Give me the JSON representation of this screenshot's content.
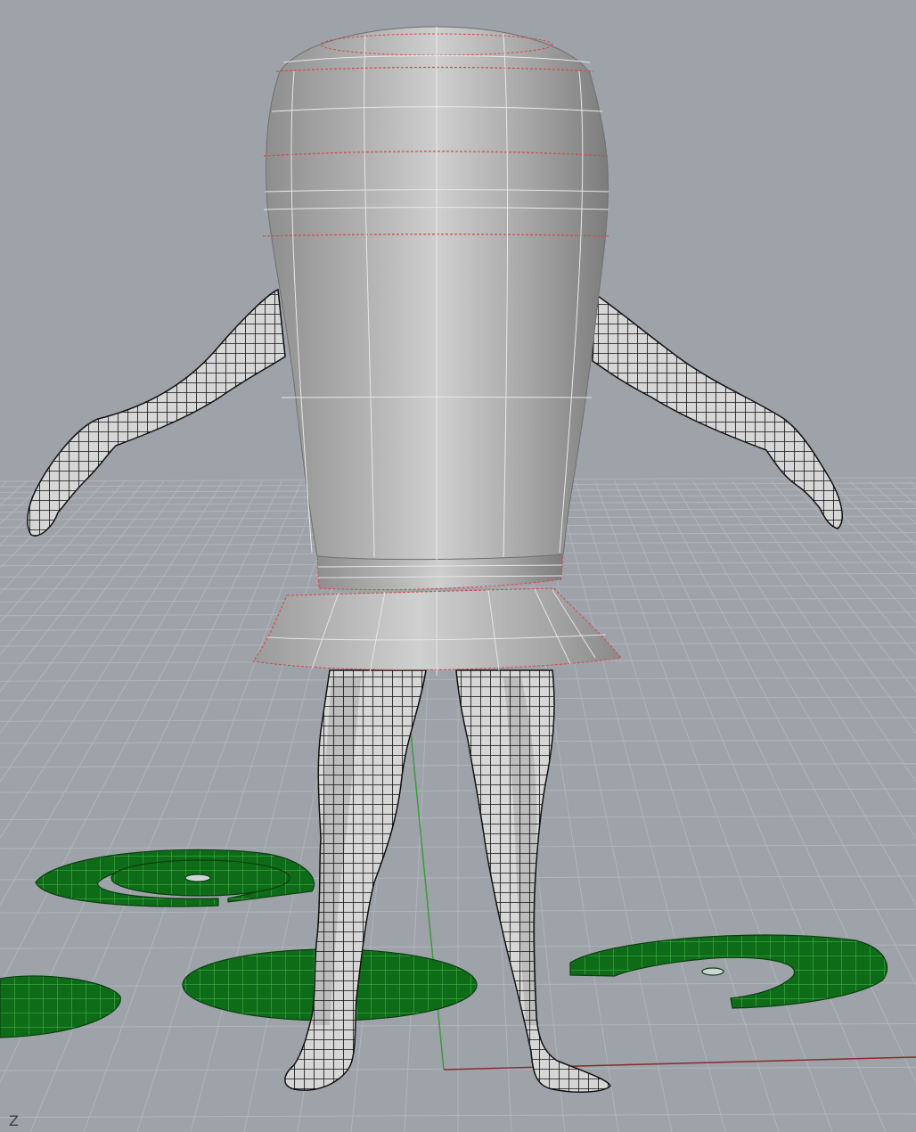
{
  "viewport": {
    "background_color": "#9ea3a9",
    "grid_color": "#b0b4ba",
    "axis_label": "Z",
    "x_axis_color": "#8a2a2a",
    "y_axis_color": "#3f9a3f"
  },
  "objects": [
    {
      "name": "torso-shell",
      "kind": "surface",
      "color": "#b9b9b9",
      "edge_color": "#d8d8d8",
      "selection_edge_color": "#d94848"
    },
    {
      "name": "skirt-flare",
      "kind": "surface",
      "color": "#b4b4b4"
    },
    {
      "name": "body-mesh",
      "kind": "wireframe-mesh",
      "color": "#d6d6d6",
      "wire_color": "#111111",
      "parts": [
        "left-arm",
        "right-arm",
        "left-leg",
        "right-leg",
        "left-foot",
        "right-foot"
      ]
    },
    {
      "name": "green-disc-patterns",
      "kind": "flat-mesh",
      "color": "#0e6c18",
      "count": 5
    }
  ]
}
